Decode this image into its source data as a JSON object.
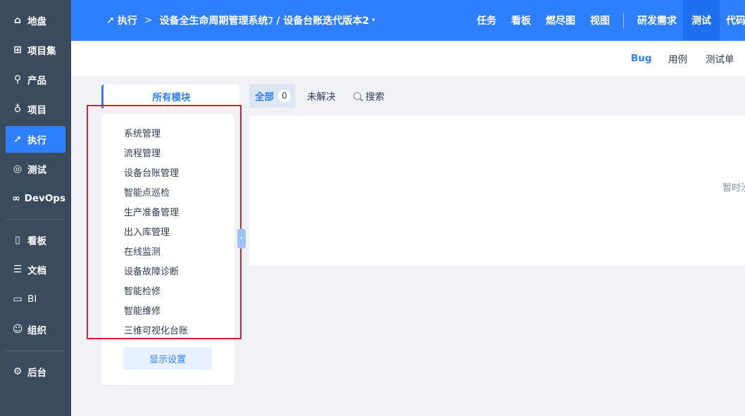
{
  "leftnav": {
    "items": [
      {
        "label": "地盘",
        "icon": "home-icon",
        "glyph": "⌂"
      },
      {
        "label": "项目集",
        "icon": "grid-icon",
        "glyph": "⊞"
      },
      {
        "label": "产品",
        "icon": "product-icon",
        "glyph": "⚲"
      },
      {
        "label": "项目",
        "icon": "project-icon",
        "glyph": "♁"
      },
      {
        "label": "执行",
        "icon": "execution-icon",
        "glyph": "➚"
      },
      {
        "label": "测试",
        "icon": "test-icon",
        "glyph": "◎"
      },
      {
        "label": "DevOps",
        "icon": "devops-icon",
        "glyph": "∞"
      },
      {
        "label": "看板",
        "icon": "kanban-icon",
        "glyph": "▯"
      },
      {
        "label": "文档",
        "icon": "doc-icon",
        "glyph": "☰"
      },
      {
        "label": "BI",
        "icon": "bi-icon",
        "glyph": "▭"
      },
      {
        "label": "组织",
        "icon": "org-icon",
        "glyph": "☺"
      },
      {
        "label": "后台",
        "icon": "gear-icon",
        "glyph": "⚙"
      }
    ]
  },
  "header": {
    "crumb_root": "执行",
    "crumb_sep": ">",
    "crumb_path": "设备全生命周期管理系统ﾌ / 设备台账迭代版本2",
    "crumb_caret": "▾",
    "tabs": [
      "任务",
      "看板",
      "燃尽图",
      "视图",
      "研发需求",
      "测试",
      "代码"
    ],
    "active_tab": "测试"
  },
  "subheader": {
    "tabs": [
      "Bug",
      "用例",
      "测试单"
    ],
    "active_tab": "Bug"
  },
  "modules": {
    "tab_label": "所有模块",
    "items": [
      "系统管理",
      "流程管理",
      "设备台账管理",
      "智能点巡检",
      "生产准备管理",
      "出入库管理",
      "在线监测",
      "设备故障诊断",
      "智能检修",
      "智能维修",
      "三维可视化台账"
    ],
    "settings_button": "显示设置"
  },
  "filters": {
    "all_label": "全部",
    "all_count": "0",
    "unresolved_label": "未解决",
    "search_label": "搜索"
  },
  "main": {
    "empty_text": "暂时沒"
  },
  "colors": {
    "accent": "#2e7fff",
    "nav_bg": "#3b4b5e",
    "highlight": "#d5232e"
  }
}
